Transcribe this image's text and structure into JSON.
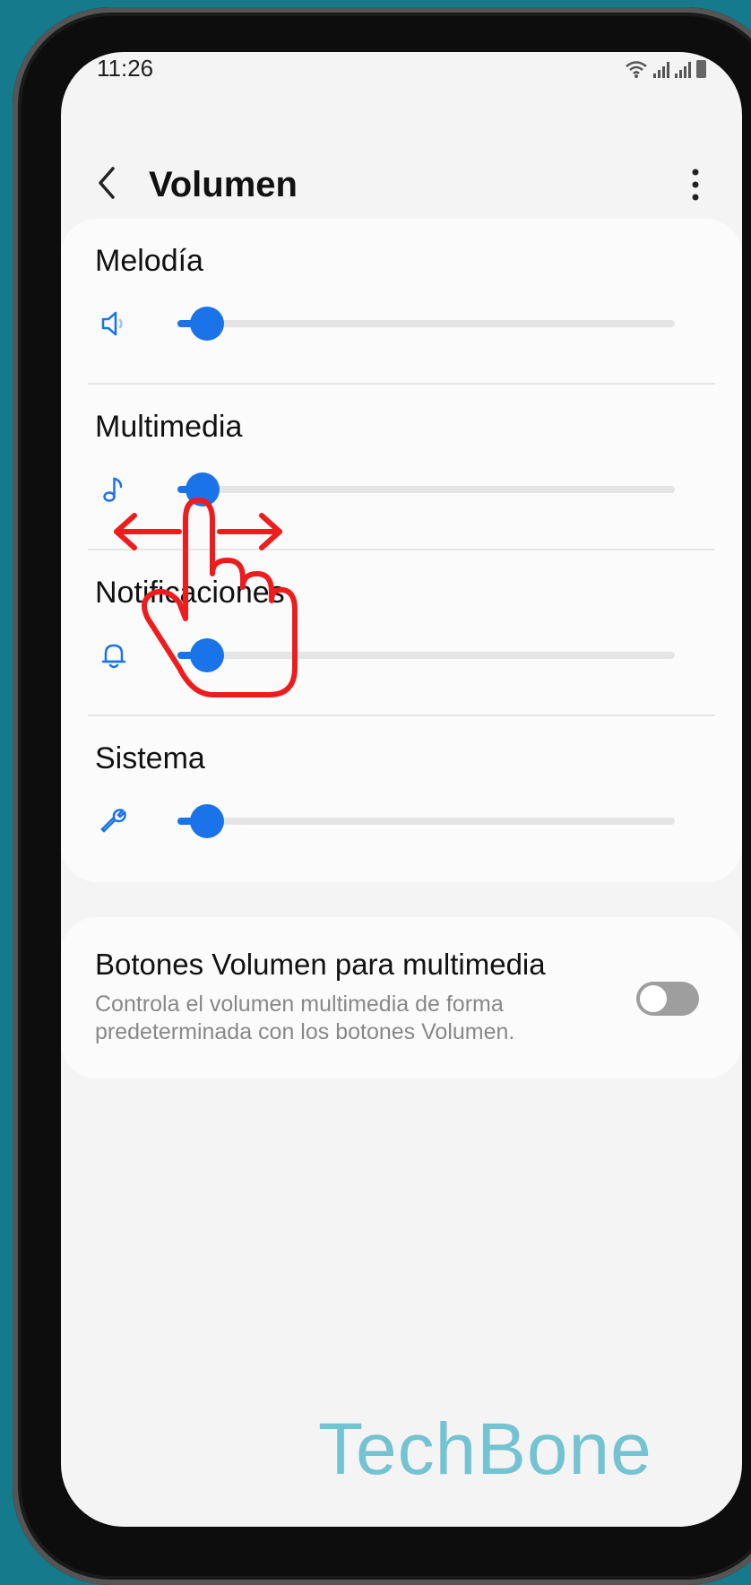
{
  "status_bar": {
    "time": "11:26"
  },
  "header": {
    "title": "Volumen"
  },
  "volume_sliders": [
    {
      "label": "Melodía",
      "icon": "speaker-icon",
      "level": 0.06
    },
    {
      "label": "Multimedia",
      "icon": "music-note-icon",
      "level": 0.05
    },
    {
      "label": "Notificaciones",
      "icon": "bell-icon",
      "level": 0.06
    },
    {
      "label": "Sistema",
      "icon": "wrench-icon",
      "level": 0.06
    }
  ],
  "media_buttons_setting": {
    "title": "Botones Volumen para multimedia",
    "description": "Controla el volumen multimedia de forma predeterminada con los botones Volumen.",
    "enabled": false
  },
  "watermark": "TechBone",
  "colors": {
    "accent": "#1a73e8",
    "gesture": "#ee1c1c",
    "background": "#157b8c",
    "watermark": "#74c3d2"
  }
}
